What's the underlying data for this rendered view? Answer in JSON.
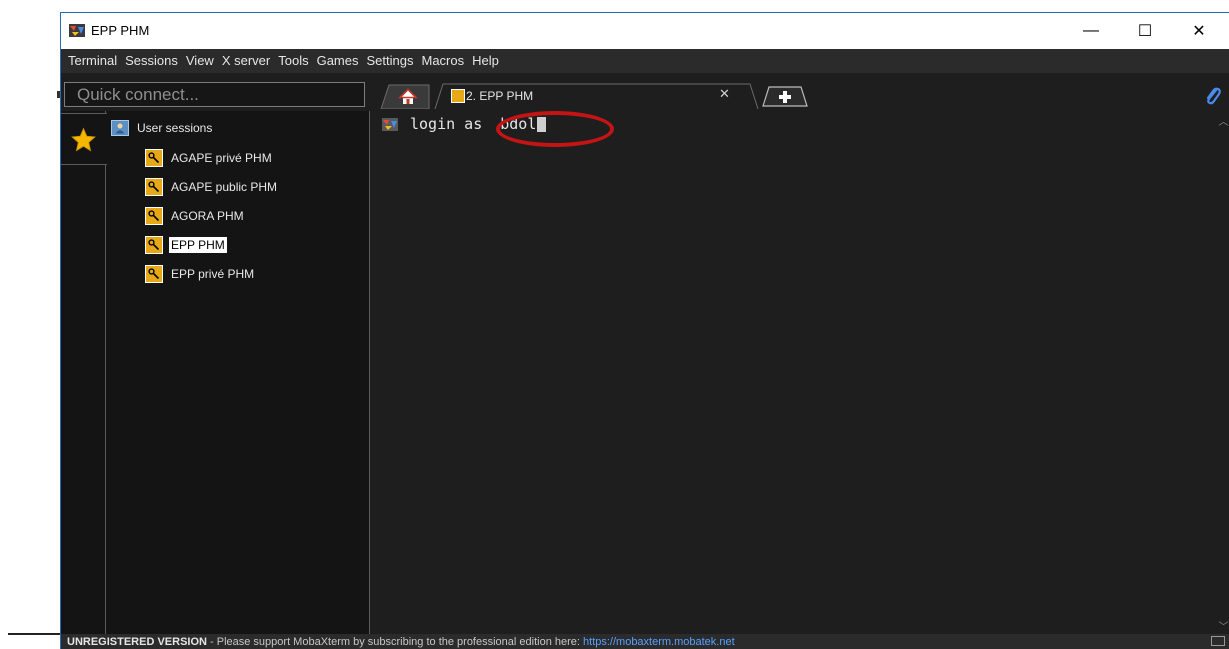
{
  "window": {
    "title": "EPP PHM"
  },
  "window_controls": {
    "minimize": "—",
    "maximize": "☐",
    "close": "✕"
  },
  "menu": [
    "Terminal",
    "Sessions",
    "View",
    "X server",
    "Tools",
    "Games",
    "Settings",
    "Macros",
    "Help"
  ],
  "quick_connect": {
    "placeholder": "Quick connect..."
  },
  "sessions": {
    "root_label": "User sessions",
    "items": [
      {
        "label": "AGAPE privé PHM"
      },
      {
        "label": "AGAPE public  PHM"
      },
      {
        "label": "AGORA PHM"
      },
      {
        "label": "EPP PHM"
      },
      {
        "label": "EPP privé PHM"
      }
    ],
    "selected": "EPP PHM"
  },
  "tabs": {
    "active_label": "2. EPP PHM",
    "close_glyph": "✕"
  },
  "terminal": {
    "prompt": "login as",
    "input": "bdol"
  },
  "status_bar": {
    "bold": "UNREGISTERED VERSION",
    "text": " -  Please support MobaXterm by subscribing to the professional edition here:  ",
    "link": "https://mobaxterm.mobatek.net"
  },
  "colors": {
    "background": "#1e1e1e",
    "menubar": "#2b2b2b",
    "key_icon": "#e6a817",
    "highlight_circle": "#c41414",
    "link": "#5aa0ff"
  },
  "icons": [
    "app-icon",
    "star-icon",
    "user-folder-icon",
    "key-icon",
    "home-icon",
    "new-tab-icon",
    "paperclip-icon",
    "terminal-icon"
  ]
}
